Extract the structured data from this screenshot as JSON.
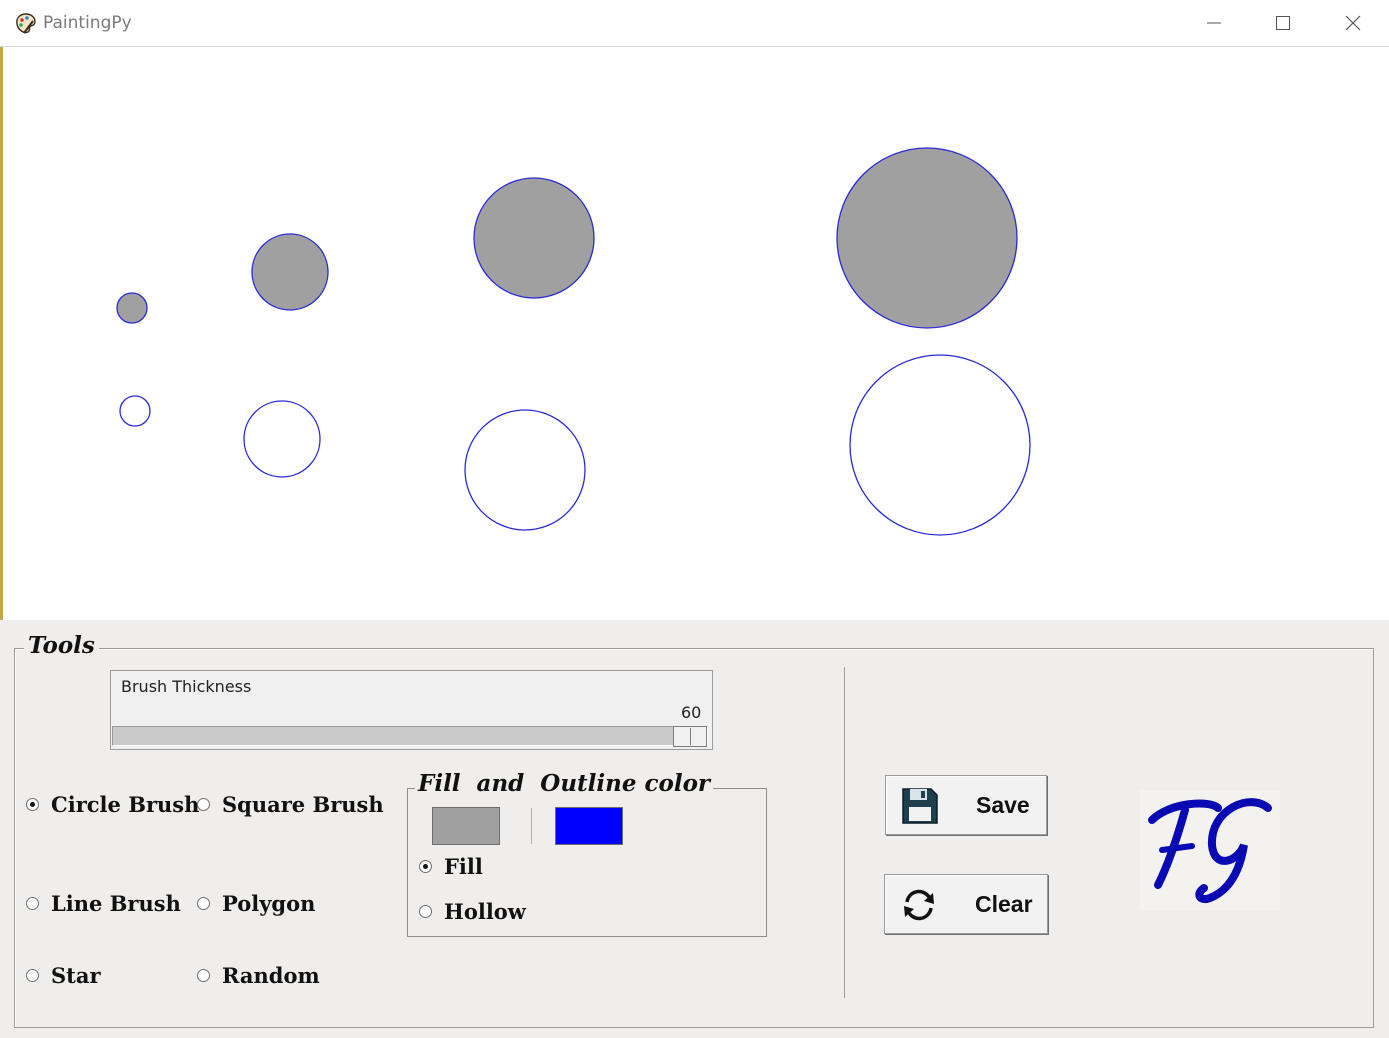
{
  "window": {
    "title": "PaintingPy",
    "controls": [
      "minimize",
      "maximize",
      "close"
    ]
  },
  "canvas": {
    "background": "#ffffff",
    "fill_color": "#a0a0a0",
    "outline_color": "#2a2adc"
  },
  "tools": {
    "legend": "Tools",
    "brush_thickness": {
      "label": "Brush Thickness",
      "value": "60",
      "fraction": 0.96
    },
    "brushes": [
      {
        "label": "Circle Brush",
        "selected": true
      },
      {
        "label": "Square Brush",
        "selected": false
      },
      {
        "label": "Line Brush",
        "selected": false
      },
      {
        "label": "Polygon",
        "selected": false
      },
      {
        "label": "Star",
        "selected": false
      },
      {
        "label": "Random",
        "selected": false
      }
    ],
    "color_group": {
      "legend": "Fill  and  Outline color",
      "fill_swatch": "#a0a0a0",
      "outline_swatch": "#0000ff",
      "modes": [
        {
          "label": "Fill",
          "selected": true
        },
        {
          "label": "Hollow",
          "selected": false
        }
      ]
    },
    "actions": {
      "save_label": "Save",
      "clear_label": "Clear",
      "save_icon": "floppy-disk-icon",
      "clear_icon": "refresh-icon"
    },
    "logo": {
      "text": "FG",
      "color": "#0a0ab4"
    }
  }
}
